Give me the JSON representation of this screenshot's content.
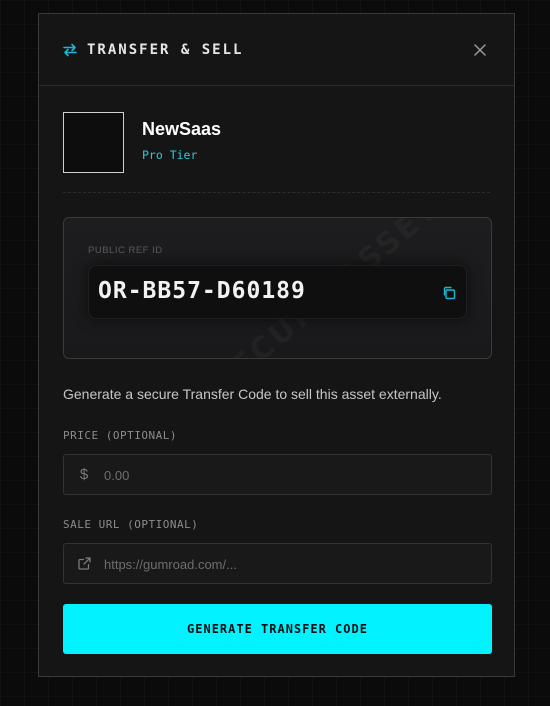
{
  "modal": {
    "title": "TRANSFER & SELL",
    "accent_color": "#19b9d6"
  },
  "asset": {
    "name": "NewSaas",
    "tier": "Pro Tier"
  },
  "reference": {
    "label": "PUBLIC REF ID",
    "value": "OR-BB57-D60189",
    "watermark": "SECURE ASSET"
  },
  "description": "Generate a secure Transfer Code to sell this asset externally.",
  "price": {
    "label": "PRICE (OPTIONAL)",
    "currency_symbol": "$",
    "placeholder": "0.00",
    "value": ""
  },
  "sale_url": {
    "label": "SALE URL (OPTIONAL)",
    "placeholder": "https://gumroad.com/...",
    "value": ""
  },
  "cta": {
    "label": "GENERATE TRANSFER CODE",
    "color": "#00f3ff"
  }
}
